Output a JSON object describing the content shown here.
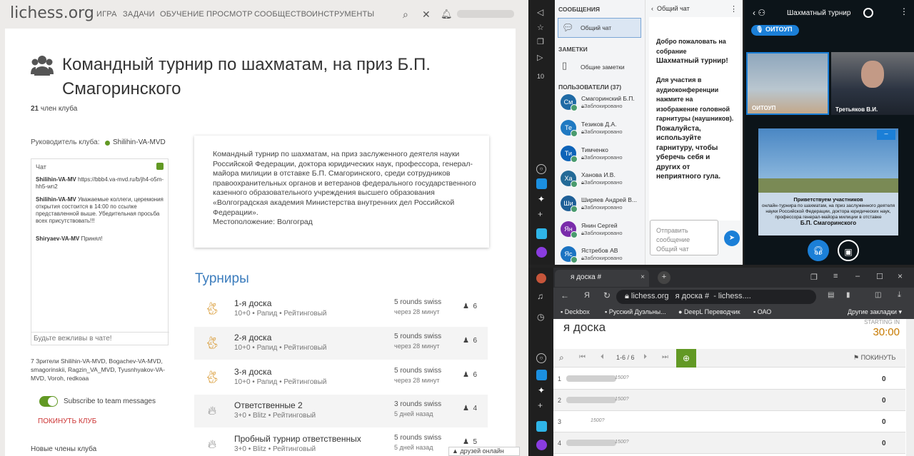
{
  "lichess": {
    "logo": "lichess.org",
    "nav": [
      "ИГРА",
      "ЗАДАЧИ",
      "ОБУЧЕНИЕ",
      "ПРОСМОТР",
      "СООБЩЕСТВО",
      "ИНСТРУМЕНТЫ"
    ],
    "team_title": "Командный турнир по шахматам, на приз Б.П. Смагоринского",
    "members_count": "21",
    "members_label": "член клуба",
    "leader_label": "Руководитель клуба:",
    "leader_name": "Shilihin-VA-MVD",
    "chat_title": "Чат",
    "chat_messages": [
      {
        "user": "Shilihin-VA-MV",
        "text": "https://bbb4.va-mvd.ru/b/jh4-o5m-hh5-wn2"
      },
      {
        "user": "Shilihin-VA-MV",
        "text": "Уважаемые коллеги, церемония открытия состоится в 14:00 по ссылке представленной выше. Убедительная просьба всех присутствовать!!!"
      },
      {
        "user": "Shiryaev-VA-MV",
        "text": "Принял!"
      }
    ],
    "chat_placeholder": "Будьте вежливы в чате!",
    "viewers": "7 Зрители Shilihin-VA-MVD, Bogachev-VA-MVD, smagorinskii, Ragzin_VA_MVD, Tyusnhyakov-VA-MVD, Voroh, redkoaa",
    "subscribe_label": "Subscribe to team messages",
    "leave_label": "ПОКИНУТЬ КЛУБ",
    "new_members_label": "Новые члены клуба",
    "description": "Командный турнир по шахматам, на приз заслуженного деятеля науки Российской Федерации, доктора юридических наук, профессора, генерал-майора милиции в отставке Б.П. Смагоринского, среди сотрудников правоохранительных органов и ветеранов федерального государственного казенного образовательного учреждения высшего образования «Волгоградская академия Министерства внутренних дел Российской Федерации».",
    "location": "Местоположение: Волгоград",
    "tournaments_heading": "Турниры",
    "tournaments": [
      {
        "name": "1-я доска",
        "sub": "10+0 • Рапид • Рейтинговый",
        "format": "5 rounds swiss",
        "when": "через 28 минут",
        "players": "6",
        "icon": "rabbit-icon"
      },
      {
        "name": "2-я доска",
        "sub": "10+0 • Рапид • Рейтинговый",
        "format": "5 rounds swiss",
        "when": "через 28 минут",
        "players": "6",
        "icon": "rabbit-icon"
      },
      {
        "name": "3-я доска",
        "sub": "10+0 • Рапид • Рейтинговый",
        "format": "5 rounds swiss",
        "when": "через 28 минут",
        "players": "6",
        "icon": "rabbit-icon"
      },
      {
        "name": "Ответственные 2",
        "sub": "3+0 • Blitz • Рейтинговый",
        "format": "3 rounds swiss",
        "when": "5 дней назад",
        "players": "4",
        "icon": "flame-icon"
      },
      {
        "name": "Пробный турнир ответственных",
        "sub": "3+0 • Blitz • Рейтинговый",
        "format": "5 rounds swiss",
        "when": "5 дней назад",
        "players": "5",
        "icon": "flame-icon"
      }
    ],
    "friends_label": "▲ друзей онлайн"
  },
  "chatapp": {
    "messages_header": "СООБЩЕНИЯ",
    "public_chat": "Общий чат",
    "notes_header": "ЗАМЕТКИ",
    "public_notes": "Общие заметки",
    "users_header": "ПОЛЬЗОВАТЕЛИ (37)",
    "back_label": "Общий чат",
    "users": [
      {
        "initials": "См",
        "name": "Смагоринский Б.П.",
        "status": "Заблокировано",
        "color": "#1f6aa5"
      },
      {
        "initials": "Те",
        "name": "Тезиков Д.А.",
        "status": "Заблокировано",
        "color": "#1f79c2"
      },
      {
        "initials": "Ти",
        "name": "Тимченко",
        "status": "Заблокировано",
        "color": "#0d63b8"
      },
      {
        "initials": "Ха",
        "name": "Ханова И.В.",
        "status": "Заблокировано",
        "color": "#236a97"
      },
      {
        "initials": "Ши",
        "name": "Ширяев Андрей В...",
        "status": "Заблокировано",
        "color": "#1e5f97"
      },
      {
        "initials": "Ян",
        "name": "Янин Сергей",
        "status": "Заблокировано",
        "color": "#7a2cab"
      },
      {
        "initials": "Яс",
        "name": "Ястребов АВ",
        "status": "Заблокировано",
        "color": "#1b73c2"
      }
    ],
    "welcome_lines": [
      "Добро пожаловать на собрание",
      "Шахматный турнир!",
      "",
      "Для участия в аудиоконференции нажмите на изображение головной гарнитуры (наушников).",
      "Пожалуйста, используйте гарнитуру, чтобы уберечь себя и других от неприятного гула."
    ],
    "message_placeholder": "Отправить сообщение Общий чат"
  },
  "video": {
    "title": "Шахматный турнир",
    "badge": "ОИТОУП",
    "thumb1_label": "ОИТОУП",
    "thumb2_label": "Третьяков В.И.",
    "slide_title": "Приветствуем участников",
    "slide_sub": "онлайн-турнира по шахматам, на приз заслуженного деятеля науки Российской Федерации, доктора юридических наук, профессора генерал-майора милиции в отставке",
    "slide_name": "Б.П. Смагоринского"
  },
  "browser": {
    "tab_title": "я доска #",
    "url_host": "lichess.org",
    "url_rest": "я доска #",
    "url_tail": "- lichess....",
    "bookmarks": [
      "Deckbox",
      "Русский Дуэльны...",
      "DeepL Переводчик",
      "ОАО",
      "Другие закладки"
    ],
    "page_title": "я доска",
    "starting_in": "STARTING IN",
    "countdown": "30:00",
    "pagination": "1-6 / 6",
    "leave_label": "ПОКИНУТЬ",
    "players": [
      {
        "num": "1",
        "rating": "1500?",
        "score": "0"
      },
      {
        "num": "2",
        "rating": "1500?",
        "score": "0"
      },
      {
        "num": "3",
        "rating": "1500?",
        "score": "0"
      },
      {
        "num": "4",
        "rating": "1500?",
        "score": "0"
      }
    ]
  }
}
